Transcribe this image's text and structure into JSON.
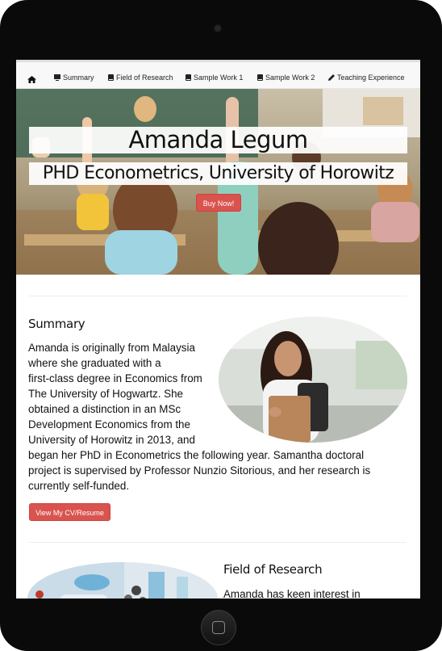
{
  "nav": {
    "items": [
      {
        "label": "Summary",
        "icon": "monitor-icon"
      },
      {
        "label": "Field of Research",
        "icon": "book-icon"
      },
      {
        "label": "Sample Work 1",
        "icon": "book-icon"
      },
      {
        "label": "Sample Work 2",
        "icon": "book-icon"
      },
      {
        "label": "Teaching Experience",
        "icon": "pencil-icon"
      }
    ],
    "home_icon": "home-icon"
  },
  "hero": {
    "title": "Amanda Legum",
    "subtitle": "PHD Econometrics, University of Horowitz",
    "cta": "Buy Now!"
  },
  "summary": {
    "heading": "Summary",
    "lines": [
      "Amanda is originally from Malaysia",
      "where she graduated with a",
      "first-class degree in Economics from",
      "The University of Hogwartz. She",
      "obtained a distinction in an MSc",
      "Development Economics from the",
      "University of Horowitz in 2013, and",
      "began her PhD in Econometrics the following year. Samantha doctoral",
      "project is supervised by Professor Nunzio Sitorious, and her research is",
      "currently self-funded."
    ],
    "cv_button": "View My CV/Resume"
  },
  "research": {
    "heading": "Field of Research",
    "text": "Amanda has keen interest in"
  },
  "colors": {
    "accent": "#d9534f",
    "navbar": "#f8f8f8"
  }
}
